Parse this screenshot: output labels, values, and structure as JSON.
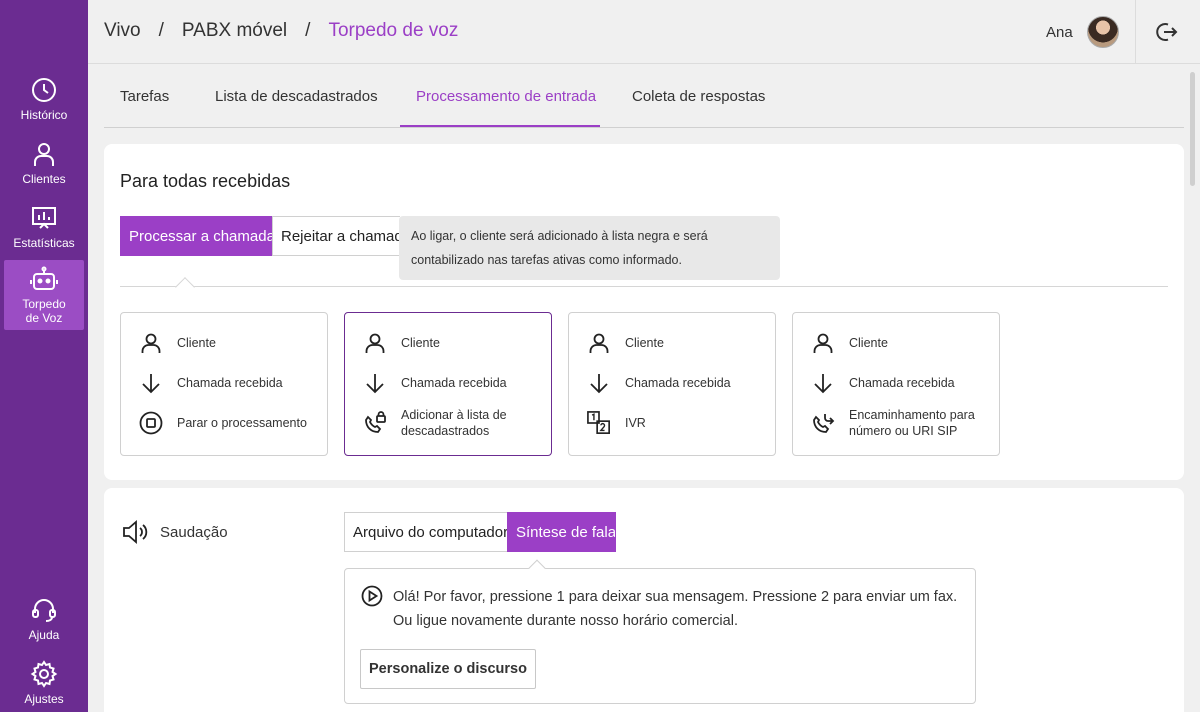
{
  "sidebar": {
    "items": [
      {
        "label": "Histórico",
        "icon": "clock-icon"
      },
      {
        "label": "Clientes",
        "icon": "person-icon"
      },
      {
        "label": "Estatísticas",
        "icon": "chart-icon"
      },
      {
        "label": "Torpedo de Voz",
        "icon": "robot-icon"
      },
      {
        "label": "Ajuda",
        "icon": "headset-icon"
      },
      {
        "label": "Ajustes",
        "icon": "gear-icon"
      }
    ]
  },
  "header": {
    "crumb1": "Vivo",
    "crumb2": "PABX móvel",
    "crumb3": "Torpedo de voz",
    "separator": "/",
    "user": "Ana"
  },
  "tabs": [
    "Tarefas",
    "Lista de descadastrados",
    "Processamento de entrada",
    "Coleta de respostas"
  ],
  "section": {
    "title": "Para todas recebidas",
    "process_btn": "Processar a chamada",
    "reject_btn": "Rejeitar a chamada",
    "tooltip": "Ao ligar, o cliente será adicionado à lista negra e será contabilizado nas tarefas ativas como informado."
  },
  "flows": [
    {
      "step1": "Cliente",
      "step2": "Chamada recebida",
      "step3": "Parar o processamento"
    },
    {
      "step1": "Cliente",
      "step2": "Chamada recebida",
      "step3": "Adicionar à lista de descadastrados"
    },
    {
      "step1": "Cliente",
      "step2": "Chamada recebida",
      "step3": "IVR"
    },
    {
      "step1": "Cliente",
      "step2": "Chamada recebida",
      "step3": "Encaminhamento para número ou URI SIP"
    }
  ],
  "greeting": {
    "label": "Saudação",
    "file_btn": "Arquivo do computador",
    "tts_btn": "Síntese de fala",
    "message": "Olá! Por favor, pressione 1 para deixar sua mensagem. Pressione 2 para enviar um fax. Ou ligue novamente durante nosso horário comercial.",
    "customize_btn": "Personalize o discurso"
  },
  "colors": {
    "sidebar": "#6b2c91",
    "accent": "#9b3fc6"
  }
}
